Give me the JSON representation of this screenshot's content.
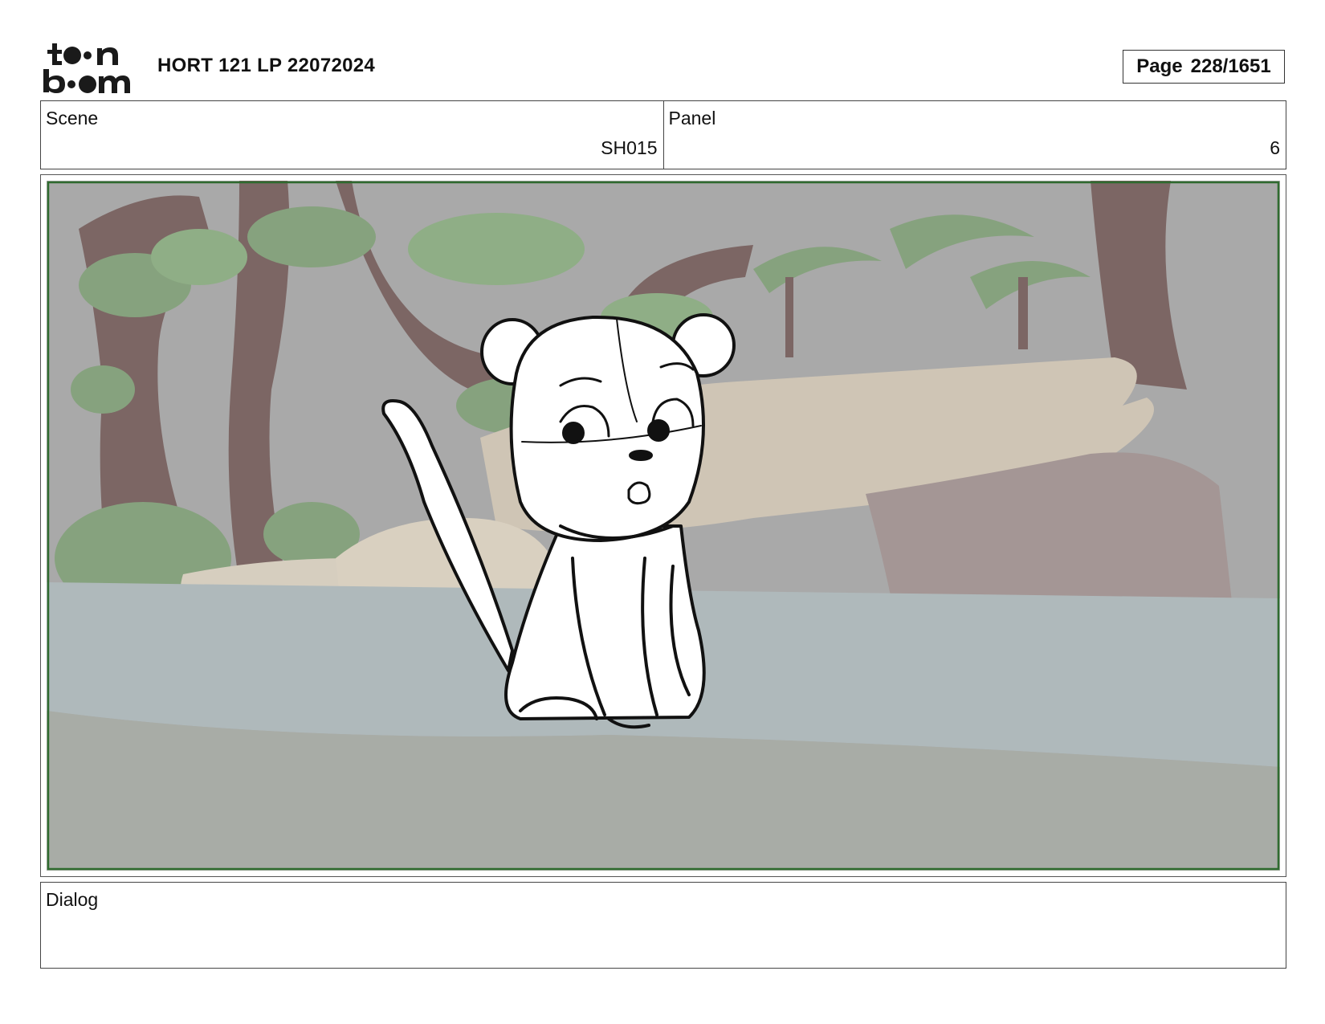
{
  "header": {
    "logo_text": "toon boom",
    "title": "HORT 121 LP 22072024",
    "page_label": "Page",
    "page_number": "228/1651"
  },
  "scene": {
    "label": "Scene",
    "value": "SH015"
  },
  "panel": {
    "label": "Panel",
    "value": "6"
  },
  "dialog": {
    "label": "Dialog",
    "text": ""
  },
  "colors": {
    "safe_area_border": "#2f6b2f",
    "sky": "#a9a9a9",
    "ground": "#a8aca6",
    "water": "#afb9bb",
    "trunk": "#7c6664",
    "foliage": "#86a27e",
    "rock": "#cfc5b5"
  }
}
